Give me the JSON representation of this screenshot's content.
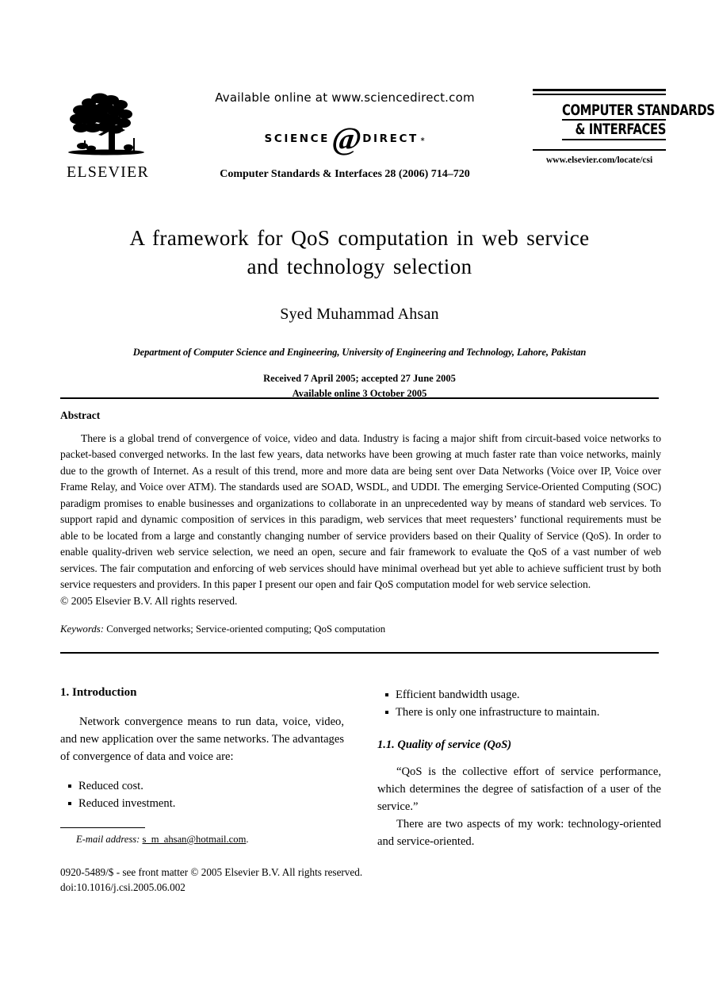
{
  "masthead": {
    "publisher": "ELSEVIER",
    "available_online": "Available online at www.sciencedirect.com",
    "sciencedirect": {
      "science": "SCIENCE",
      "at": "@",
      "direct": "DIRECT",
      "tm": "∗"
    },
    "journal_reference": "Computer Standards & Interfaces 28 (2006) 714–720",
    "journal_logo_line1": "COMPUTER STANDARDS",
    "journal_logo_line2": "& INTERFACES",
    "journal_url": "www.elsevier.com/locate/csi"
  },
  "article": {
    "title_line1": "A framework for QoS computation in web service",
    "title_line2": "and technology selection",
    "author": "Syed Muhammad Ahsan",
    "affiliation": "Department of Computer Science and Engineering, University of Engineering and Technology, Lahore, Pakistan",
    "received": "Received 7 April 2005; accepted 27 June 2005",
    "available_online": "Available online 3 October 2005"
  },
  "abstract": {
    "heading": "Abstract",
    "body": "There is a global trend of convergence of voice, video and data. Industry is facing a major shift from circuit-based voice networks to packet-based converged networks. In the last few years, data networks have been growing at much faster rate than voice networks, mainly due to the growth of Internet. As a result of this trend, more and more data are being sent over Data Networks (Voice over IP, Voice over Frame Relay, and Voice over ATM). The standards used are SOAD, WSDL, and UDDI. The emerging Service-Oriented Computing (SOC) paradigm promises to enable businesses and organizations to collaborate in an unprecedented way by means of standard web services. To support rapid and dynamic composition of services in this paradigm, web services that meet requesters’ functional requirements must be able to be located from a large and constantly changing number of service providers based on their Quality of Service (QoS). In order to enable quality-driven web service selection, we need an open, secure and fair framework to evaluate the QoS of a vast number of web services. The fair computation and enforcing of web services should have minimal overhead but yet able to achieve sufficient trust by both service requesters and providers. In this paper I present our open and fair QoS computation model for web service selection.",
    "copyright": "© 2005 Elsevier B.V. All rights reserved.",
    "keywords_label": "Keywords:",
    "keywords_value": "Converged networks; Service-oriented computing; QoS computation"
  },
  "sections": {
    "introduction": {
      "heading": "1. Introduction",
      "paragraph": "Network convergence means to run data, voice, video, and new application over the same networks. The advantages of convergence of data and voice are:",
      "advantages_left": [
        "Reduced cost.",
        "Reduced investment."
      ],
      "advantages_right": [
        "Efficient bandwidth usage.",
        "There is only one infrastructure to maintain."
      ]
    },
    "qos": {
      "heading": "1.1. Quality of service (QoS)",
      "quote": "“QoS is the collective effort of service performance, which determines the degree of satisfaction of a user of the service.”",
      "paragraph": "There are two aspects of my work: technology-oriented and service-oriented."
    }
  },
  "footnote": {
    "email_label": "E-mail address:",
    "email_address": "s_m_ahsan@hotmail.com",
    "email_period": ".",
    "front_matter": "0920-5489/$ - see front matter © 2005 Elsevier B.V. All rights reserved.",
    "doi": "doi:10.1016/j.csi.2005.06.002"
  }
}
